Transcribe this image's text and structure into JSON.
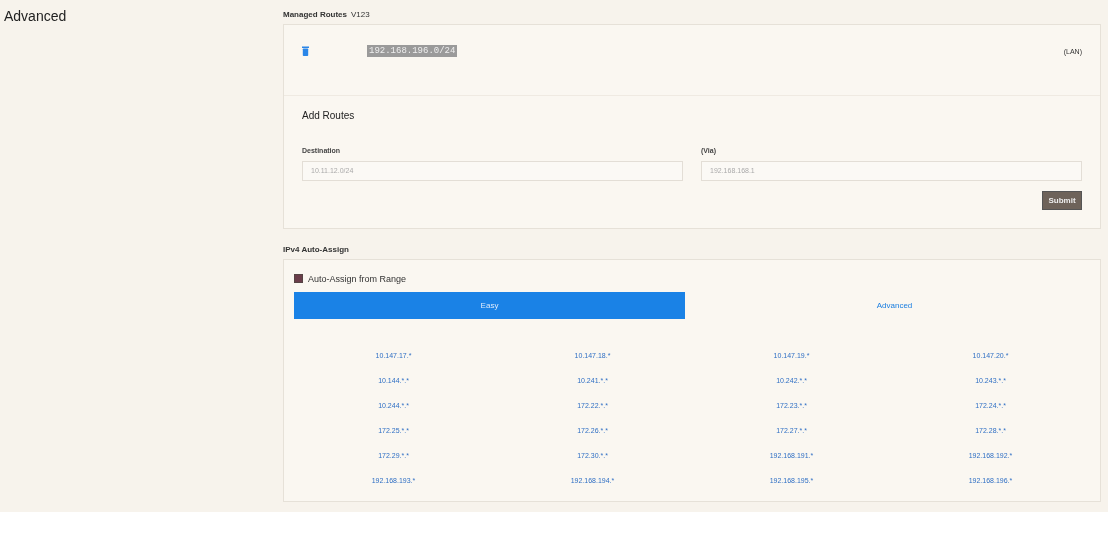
{
  "sidebar": {
    "title": "Advanced"
  },
  "managed_routes": {
    "title": "Managed Routes",
    "count": "V123",
    "routes": [
      {
        "target": "192.168.196.0/24",
        "via": "(LAN)"
      }
    ],
    "add_routes": {
      "title": "Add Routes",
      "destination_label": "Destination",
      "destination_placeholder": "10.11.12.0/24",
      "via_label": "(Via)",
      "via_placeholder": "192.168.168.1",
      "submit": "Submit"
    }
  },
  "ipv4_auto_assign": {
    "title": "IPv4 Auto-Assign",
    "auto_assign": {
      "label": "Auto-Assign from Range",
      "checked": true
    },
    "tabs": [
      {
        "label": "Easy",
        "selected": true
      },
      {
        "label": "Advanced",
        "selected": false
      }
    ],
    "ranges": [
      "10.147.17.*",
      "10.147.18.*",
      "10.147.19.*",
      "10.147.20.*",
      "10.144.*.*",
      "10.241.*.*",
      "10.242.*.*",
      "10.243.*.*",
      "10.244.*.*",
      "172.22.*.*",
      "172.23.*.*",
      "172.24.*.*",
      "172.25.*.*",
      "172.26.*.*",
      "172.27.*.*",
      "172.28.*.*",
      "172.29.*.*",
      "172.30.*.*",
      "192.168.191.*",
      "192.168.192.*",
      "192.168.193.*",
      "192.168.194.*",
      "192.168.195.*",
      "192.168.196.*"
    ]
  }
}
